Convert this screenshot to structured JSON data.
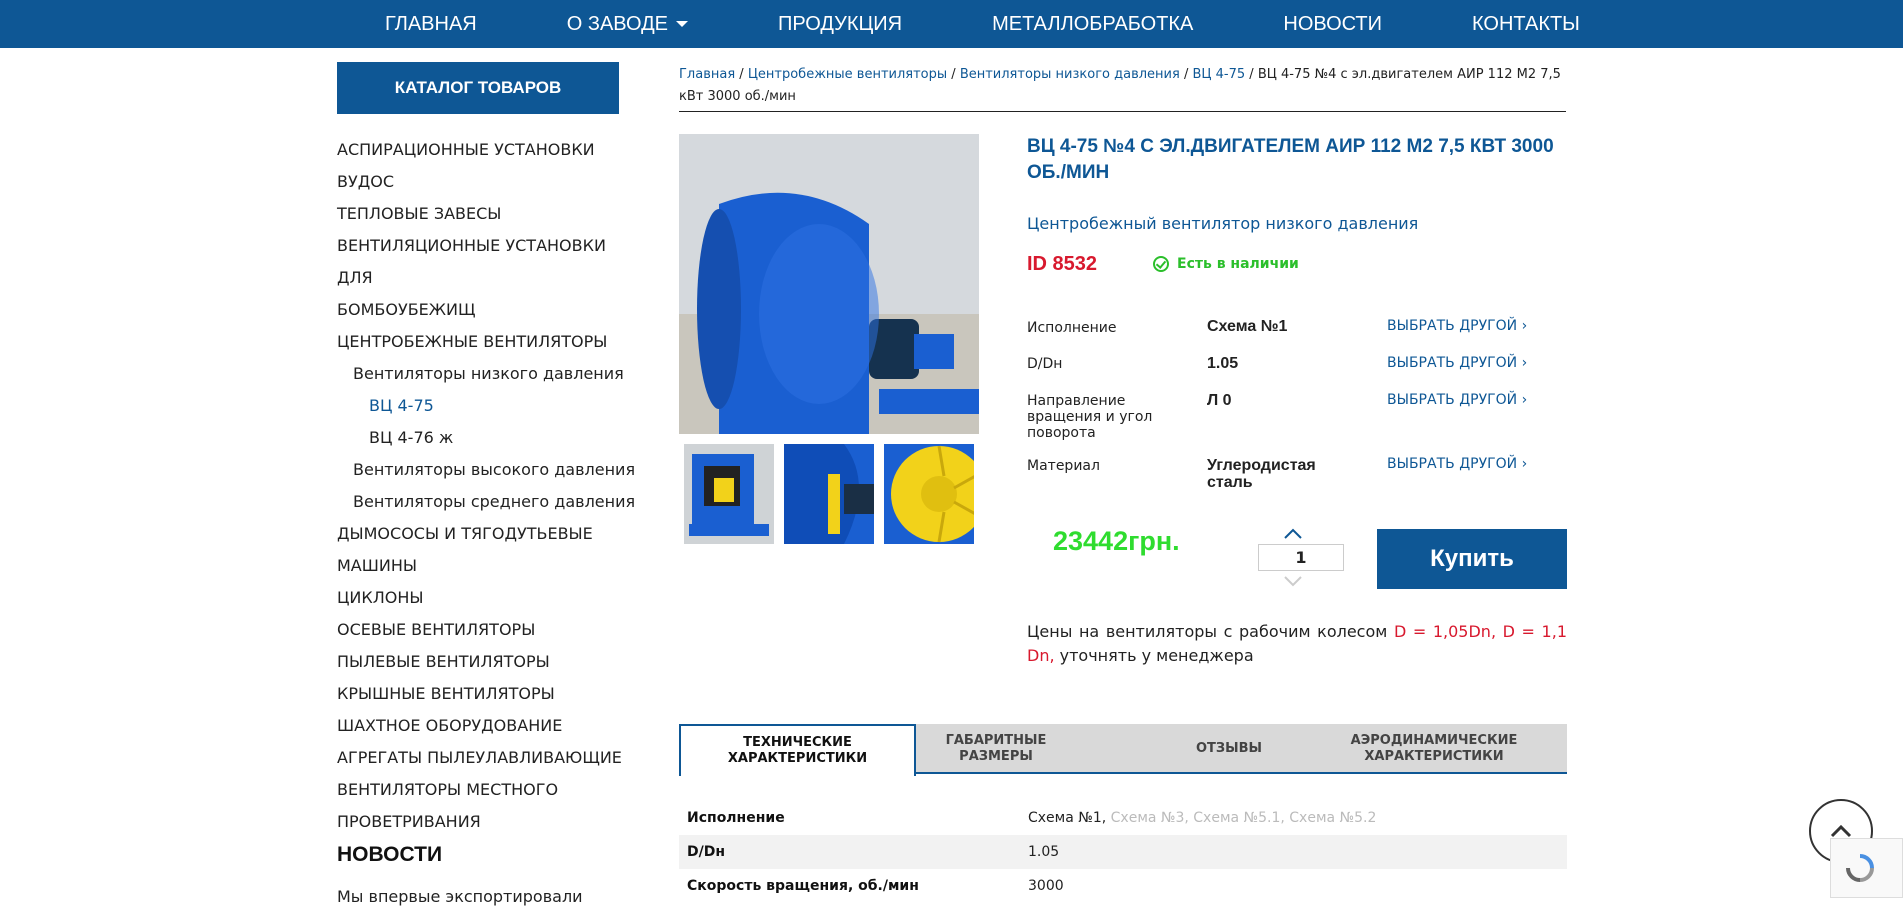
{
  "nav": {
    "items": [
      "ГЛАВНАЯ",
      "О ЗАВОДЕ",
      "ПРОДУКЦИЯ",
      "МЕТАЛЛОБРАБОТКА",
      "НОВОСТИ",
      "КОНТАКТЫ"
    ]
  },
  "sidebar": {
    "catalog_button": "КАТАЛОГ ТОВАРОВ",
    "items": [
      {
        "label": "АСПИРАЦИОННЫЕ УСТАНОВКИ",
        "level": 1
      },
      {
        "label": "ВУДОС",
        "level": 1
      },
      {
        "label": "ТЕПЛОВЫЕ ЗАВЕСЫ",
        "level": 1
      },
      {
        "label": "ВЕНТИЛЯЦИОННЫЕ УСТАНОВКИ ДЛЯ",
        "level": 1
      },
      {
        "label": "БОМБОУБЕЖИЩ",
        "level": 1
      },
      {
        "label": "ЦЕНТРОБЕЖНЫЕ ВЕНТИЛЯТОРЫ",
        "level": 1
      },
      {
        "label": "Вентиляторы низкого давления",
        "level": 2
      },
      {
        "label": "ВЦ 4-75",
        "level": 3
      },
      {
        "label": "ВЦ 4-76 ж",
        "level": 3
      },
      {
        "label": "Вентиляторы высокого давления",
        "level": 2
      },
      {
        "label": "Вентиляторы среднего давления",
        "level": 2
      },
      {
        "label": "ДЫМОСОСЫ И ТЯГОДУТЬЕВЫЕ",
        "level": 1
      },
      {
        "label": "МАШИНЫ",
        "level": 1
      },
      {
        "label": "ЦИКЛОНЫ",
        "level": 1
      },
      {
        "label": "ОСЕВЫЕ ВЕНТИЛЯТОРЫ",
        "level": 1
      },
      {
        "label": "ПЫЛЕВЫЕ ВЕНТИЛЯТОРЫ",
        "level": 1
      },
      {
        "label": "КРЫШНЫЕ ВЕНТИЛЯТОРЫ",
        "level": 1
      },
      {
        "label": "ШАХТНОЕ ОБОРУДОВАНИЕ",
        "level": 1
      },
      {
        "label": "АГРЕГАТЫ ПЫЛЕУЛАВЛИВАЮЩИЕ",
        "level": 1
      },
      {
        "label": "ВЕНТИЛЯТОРЫ МЕСТНОГО",
        "level": 1
      },
      {
        "label": "ПРОВЕТРИВАНИЯ",
        "level": 1
      }
    ],
    "news_heading": "НОВОСТИ",
    "news_item": "Мы впервые экспортировали"
  },
  "breadcrumb": {
    "links": [
      "Главная",
      "Центробежные вентиляторы",
      "Вентиляторы низкого давления",
      "ВЦ 4-75"
    ],
    "current": "ВЦ 4-75 №4 с эл.двигателем АИР 112 М2 7,5 кВт 3000 об./мин",
    "separator": " / "
  },
  "product": {
    "title": "ВЦ 4-75 №4 С ЭЛ.ДВИГАТЕЛЕМ АИР 112 М2 7,5 КВТ 3000 ОБ./МИН",
    "subtitle": "Центробежный вентилятор низкого давления",
    "id": "ID 8532",
    "stock": "Есть в наличии",
    "options": [
      {
        "label": "Исполнение",
        "value": "Схема №1",
        "link": "ВЫБРАТЬ ДРУГОЙ ›"
      },
      {
        "label": "D/Dн",
        "value": "1.05",
        "link": "ВЫБРАТЬ ДРУГОЙ ›"
      },
      {
        "label": "Направление вращения и угол поворота",
        "value": "Л 0",
        "link": "ВЫБРАТЬ ДРУГОЙ ›"
      },
      {
        "label": "Материал",
        "value": "Углеродистая сталь",
        "link": "ВЫБРАТЬ ДРУГОЙ ›"
      }
    ],
    "price": "23442грн.",
    "quantity": "1",
    "buy_label": "Купить",
    "note_prefix": "Цены на вентиляторы с рабочим колесом ",
    "note_highlight": "D = 1,05Dn, D = 1,1 Dn,",
    "note_suffix": " уточнять у менеджера"
  },
  "tabs": [
    {
      "label": "ТЕХНИЧЕСКИЕ ХАРАКТЕРИСТИКИ",
      "active": true
    },
    {
      "label": "ГАБАРИТНЫЕ РАЗМЕРЫ",
      "active": false
    },
    {
      "label": "ОТЗЫВЫ",
      "active": false
    },
    {
      "label": "АЭРОДИНАМИЧЕСКИЕ ХАРАКТЕРИСТИКИ",
      "active": false
    }
  ],
  "specs": [
    {
      "key": "Исполнение",
      "value": "Схема №1",
      "others": [
        "Схема №3",
        "Схема №5.1",
        "Схема №5.2"
      ]
    },
    {
      "key": "D/Dн",
      "value": "1.05",
      "others": []
    },
    {
      "key": "Скорость вращения, об./мин",
      "value": "3000",
      "others": []
    }
  ],
  "colors": {
    "brand_blue": "#0e5795",
    "price_green": "#2fdc2f",
    "stock_green": "#2bbf2b",
    "id_red": "#d8192e",
    "fan_blue": "#1a5fd1",
    "impeller_yellow": "#f2d21a"
  }
}
